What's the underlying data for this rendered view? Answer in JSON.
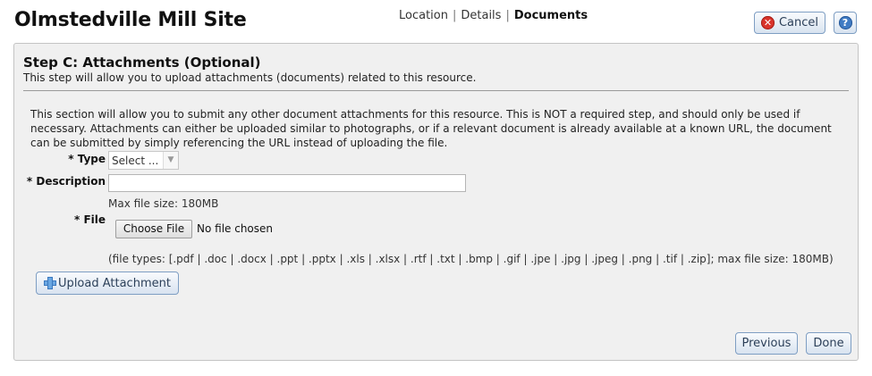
{
  "header": {
    "title": "Olmstedville Mill Site",
    "steps": [
      {
        "label": "Location",
        "current": false
      },
      {
        "label": "Details",
        "current": false
      },
      {
        "label": "Documents",
        "current": true
      }
    ],
    "separator": "|",
    "cancel_label": "Cancel",
    "cancel_icon": "cancel-x-icon",
    "help_icon": "help-question-icon"
  },
  "step": {
    "heading": "Step C: Attachments (Optional)",
    "subheading": "This step will allow you to upload attachments (documents) related to this resource.",
    "intro": "This section will allow you to submit any other document attachments for this resource. This is NOT a required step, and should only be used if necessary. Attachments can either be uploaded similar to photographs, or if a relevant document is already available at a known URL, the document can be submitted by simply referencing the URL instead of uploading the file."
  },
  "form": {
    "type_label": "* Type",
    "type_value": "Select ...",
    "description_label": "* Description",
    "description_value": "",
    "max_file_size": "Max file size: 180MB",
    "file_label": "* File",
    "choose_file_label": "Choose File",
    "no_file_text": "No file chosen",
    "file_types": "(file types: [.pdf | .doc | .docx | .ppt | .pptx | .xls | .xlsx | .rtf | .txt | .bmp | .gif | .jpe | .jpg | .jpeg | .png | .tif | .zip]; max file size: 180MB)"
  },
  "actions": {
    "upload_label": "Upload Attachment",
    "previous_label": "Previous",
    "done_label": "Done"
  },
  "colors": {
    "panel_bg": "#f0f0f0",
    "button_border": "#7e9ec3",
    "cancel_icon": "#d9342b",
    "help_icon": "#3f7bc4"
  }
}
